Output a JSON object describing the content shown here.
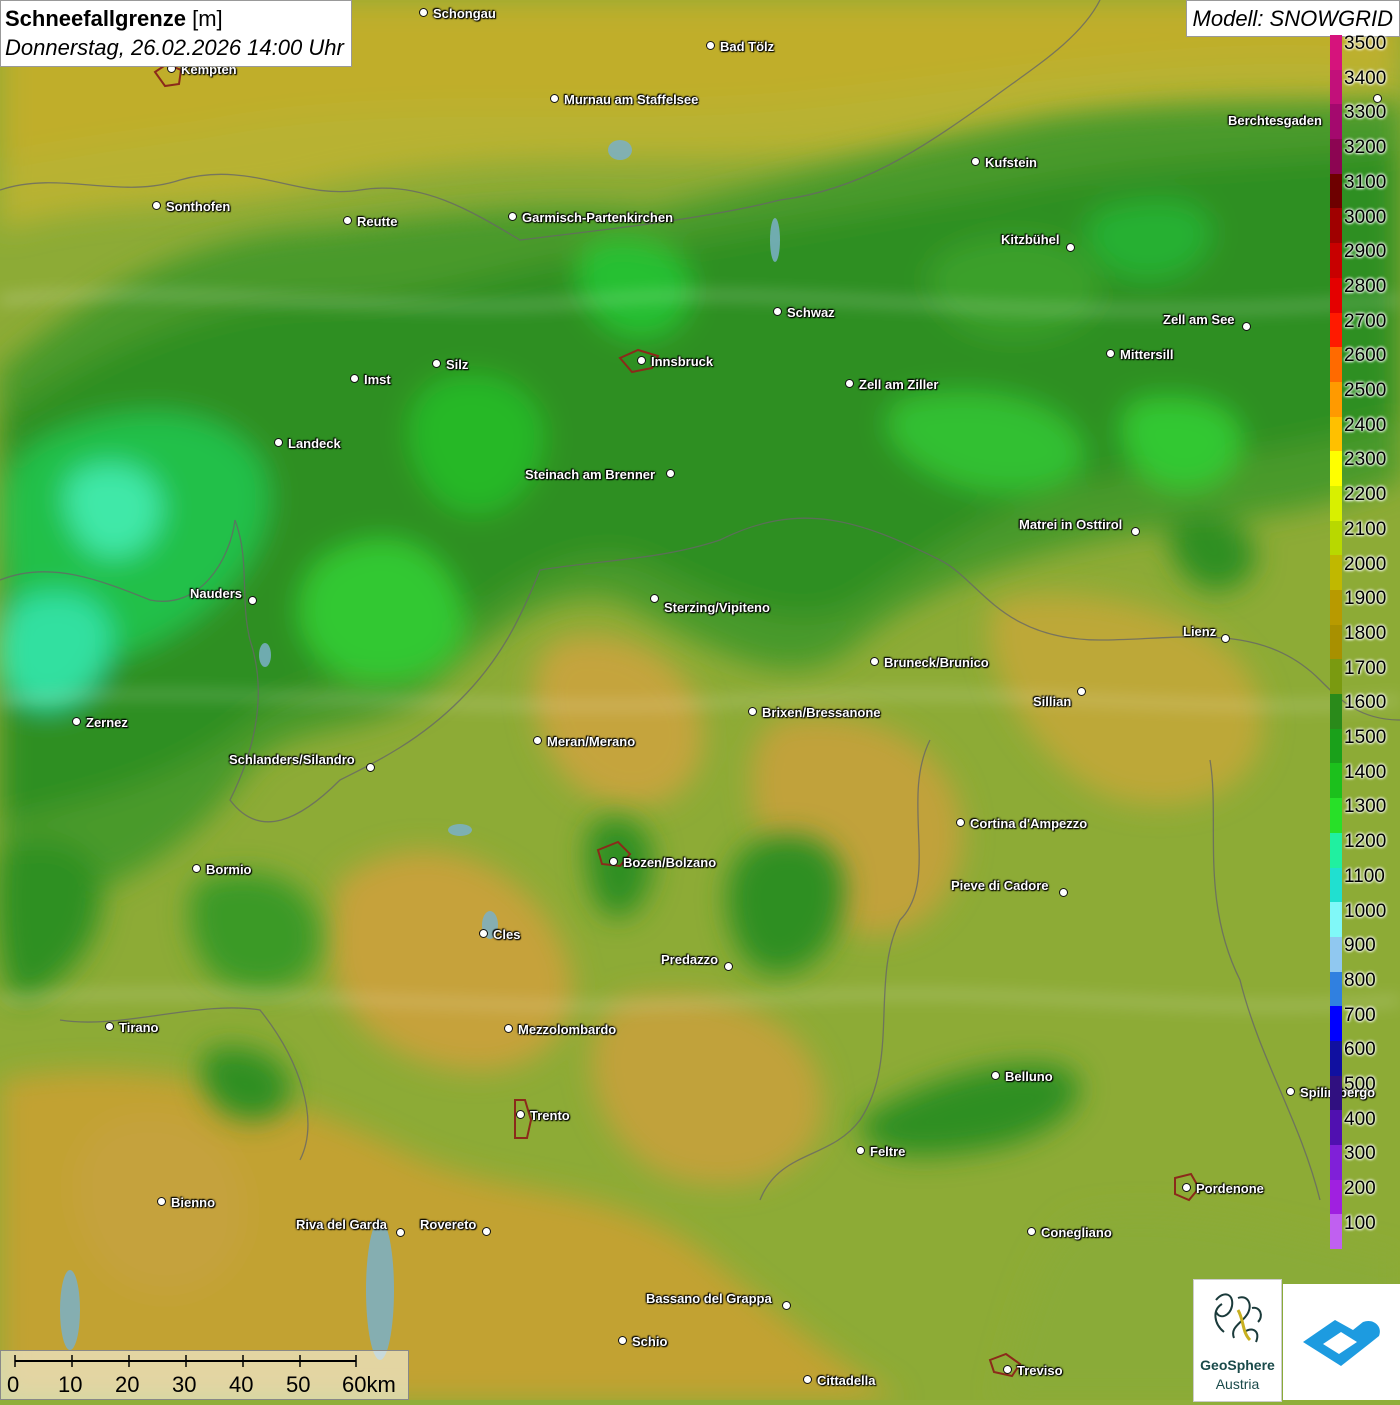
{
  "title": {
    "main": "Schneefallgrenze",
    "unit": "[m]",
    "datetime": "Donnerstag, 26.02.2026 14:00 Uhr"
  },
  "model": "Modell: SNOWGRID",
  "legend": {
    "labels": [
      "3500",
      "3400",
      "3300",
      "3200",
      "3100",
      "3000",
      "2900",
      "2800",
      "2700",
      "2600",
      "2500",
      "2400",
      "2300",
      "2200",
      "2100",
      "2000",
      "1900",
      "1800",
      "1700",
      "1600",
      "1500",
      "1400",
      "1300",
      "1200",
      "1100",
      "1000",
      "900",
      "800",
      "700",
      "600",
      "500",
      "400",
      "300",
      "200",
      "100"
    ],
    "colors": [
      "#d6137c",
      "#c2107a",
      "#a4096e",
      "#8c0552",
      "#6e0000",
      "#a00000",
      "#c80000",
      "#e40000",
      "#ff1a00",
      "#ff6a00",
      "#ff9a00",
      "#ffc000",
      "#ffff00",
      "#d8f000",
      "#b8d800",
      "#c0b800",
      "#b89a00",
      "#a89000",
      "#7a9a10",
      "#2a8a1a",
      "#1aa01a",
      "#1cc01c",
      "#28e028",
      "#20f0a0",
      "#20e0d0",
      "#80f8f8",
      "#90c8f0",
      "#3080e0",
      "#0000ff",
      "#1010a0",
      "#301080",
      "#5010b0",
      "#8020d8",
      "#a020e0",
      "#c060f0"
    ]
  },
  "cities": [
    {
      "name": "Schongau"
    },
    {
      "name": "Bad Tölz"
    },
    {
      "name": "Kempten"
    },
    {
      "name": "Murnau am Staffelsee"
    },
    {
      "name": "Berchtesgaden"
    },
    {
      "name": "Kufstein"
    },
    {
      "name": "Sonthofen"
    },
    {
      "name": "Reutte"
    },
    {
      "name": "Garmisch-Partenkirchen"
    },
    {
      "name": "Kitzbühel"
    },
    {
      "name": "Schwaz"
    },
    {
      "name": "Zell am See"
    },
    {
      "name": "Innsbruck"
    },
    {
      "name": "Mittersill"
    },
    {
      "name": "Imst"
    },
    {
      "name": "Silz"
    },
    {
      "name": "Zell am Ziller"
    },
    {
      "name": "Landeck"
    },
    {
      "name": "Steinach am Brenner"
    },
    {
      "name": "Matrei in Osttirol"
    },
    {
      "name": "Nauders"
    },
    {
      "name": "Sterzing/Vipiteno"
    },
    {
      "name": "Lienz"
    },
    {
      "name": "Bruneck/Brunico"
    },
    {
      "name": "Sillian"
    },
    {
      "name": "Zernez"
    },
    {
      "name": "Brixen/Bressanone"
    },
    {
      "name": "Meran/Merano"
    },
    {
      "name": "Schlanders/Silandro"
    },
    {
      "name": "Cortina d'Ampezzo"
    },
    {
      "name": "Bozen/Bolzano"
    },
    {
      "name": "Bormio"
    },
    {
      "name": "Pieve di Cadore"
    },
    {
      "name": "Cles"
    },
    {
      "name": "Predazzo"
    },
    {
      "name": "Tirano"
    },
    {
      "name": "Mezzolombardo"
    },
    {
      "name": "Belluno"
    },
    {
      "name": "Spilimbergo"
    },
    {
      "name": "Trento"
    },
    {
      "name": "Feltre"
    },
    {
      "name": "Pordenone"
    },
    {
      "name": "Bienno"
    },
    {
      "name": "Riva del Garda"
    },
    {
      "name": "Rovereto"
    },
    {
      "name": "Conegliano"
    },
    {
      "name": "Bassano del Grappa"
    },
    {
      "name": "Schio"
    },
    {
      "name": "Treviso"
    },
    {
      "name": "Cittadella"
    }
  ],
  "scalebar": {
    "labels": [
      "0",
      "10",
      "20",
      "30",
      "40",
      "50",
      "60km"
    ]
  },
  "logos": {
    "geosphere_line1": "GeoSphere",
    "geosphere_line2": "Austria"
  }
}
